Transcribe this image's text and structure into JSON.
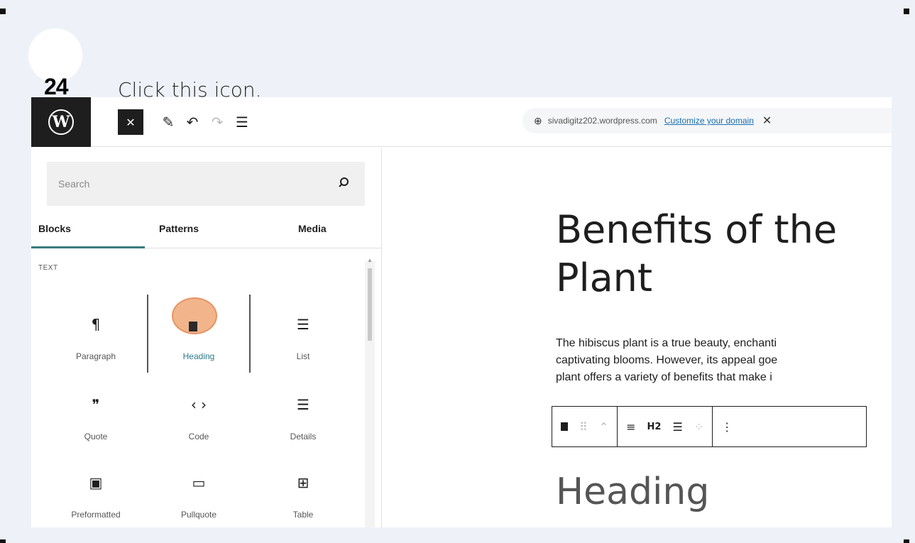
{
  "instruction": {
    "step_number": "24",
    "text": "Click this icon."
  },
  "topbar": {
    "logo": "W",
    "close_icon": "✕",
    "pencil_icon": "✎",
    "undo_icon": "↶",
    "redo_icon": "↷",
    "list_view_icon": "☰",
    "site_url": "sivadigitz202.wordpress.com",
    "customize_link": "Customize your domain",
    "dismiss_icon": "✕",
    "globe_icon": "⊕"
  },
  "sidebar": {
    "search_placeholder": "Search",
    "search_icon": "⚲",
    "tabs": [
      {
        "label": "Blocks",
        "active": true
      },
      {
        "label": "Patterns",
        "active": false
      },
      {
        "label": "Media",
        "active": false
      }
    ],
    "category": "TEXT",
    "blocks": [
      {
        "label": "Paragraph",
        "icon": "¶"
      },
      {
        "label": "Heading",
        "icon": "bookmark"
      },
      {
        "label": "List",
        "icon": "☰"
      },
      {
        "label": "Quote",
        "icon": "❞"
      },
      {
        "label": "Code",
        "icon": "‹ ›"
      },
      {
        "label": "Details",
        "icon": "☰"
      },
      {
        "label": "Preformatted",
        "icon": "▣"
      },
      {
        "label": "Pullquote",
        "icon": "▭"
      },
      {
        "label": "Table",
        "icon": "⊞"
      }
    ]
  },
  "editor": {
    "title_line1": "Benefits of the",
    "title_line2": "Plant",
    "paragraph_lines": [
      "The hibiscus plant is a true beauty, enchanti",
      "captivating blooms. However, its appeal goe",
      "plant offers a variety of benefits that make i"
    ],
    "toolbar": {
      "drag_icon": "⠿",
      "move_icon": "⌃",
      "align_icon": "≡",
      "level_label": "H2",
      "text_align_icon": "☰",
      "more_rich_icon": "⁘",
      "options_icon": "⋮"
    },
    "heading_placeholder": "Heading"
  },
  "colors": {
    "accent": "#3a7c7c",
    "highlight": "#f2b48b",
    "link": "#1a6fb0",
    "dark": "#1e1e1e"
  }
}
